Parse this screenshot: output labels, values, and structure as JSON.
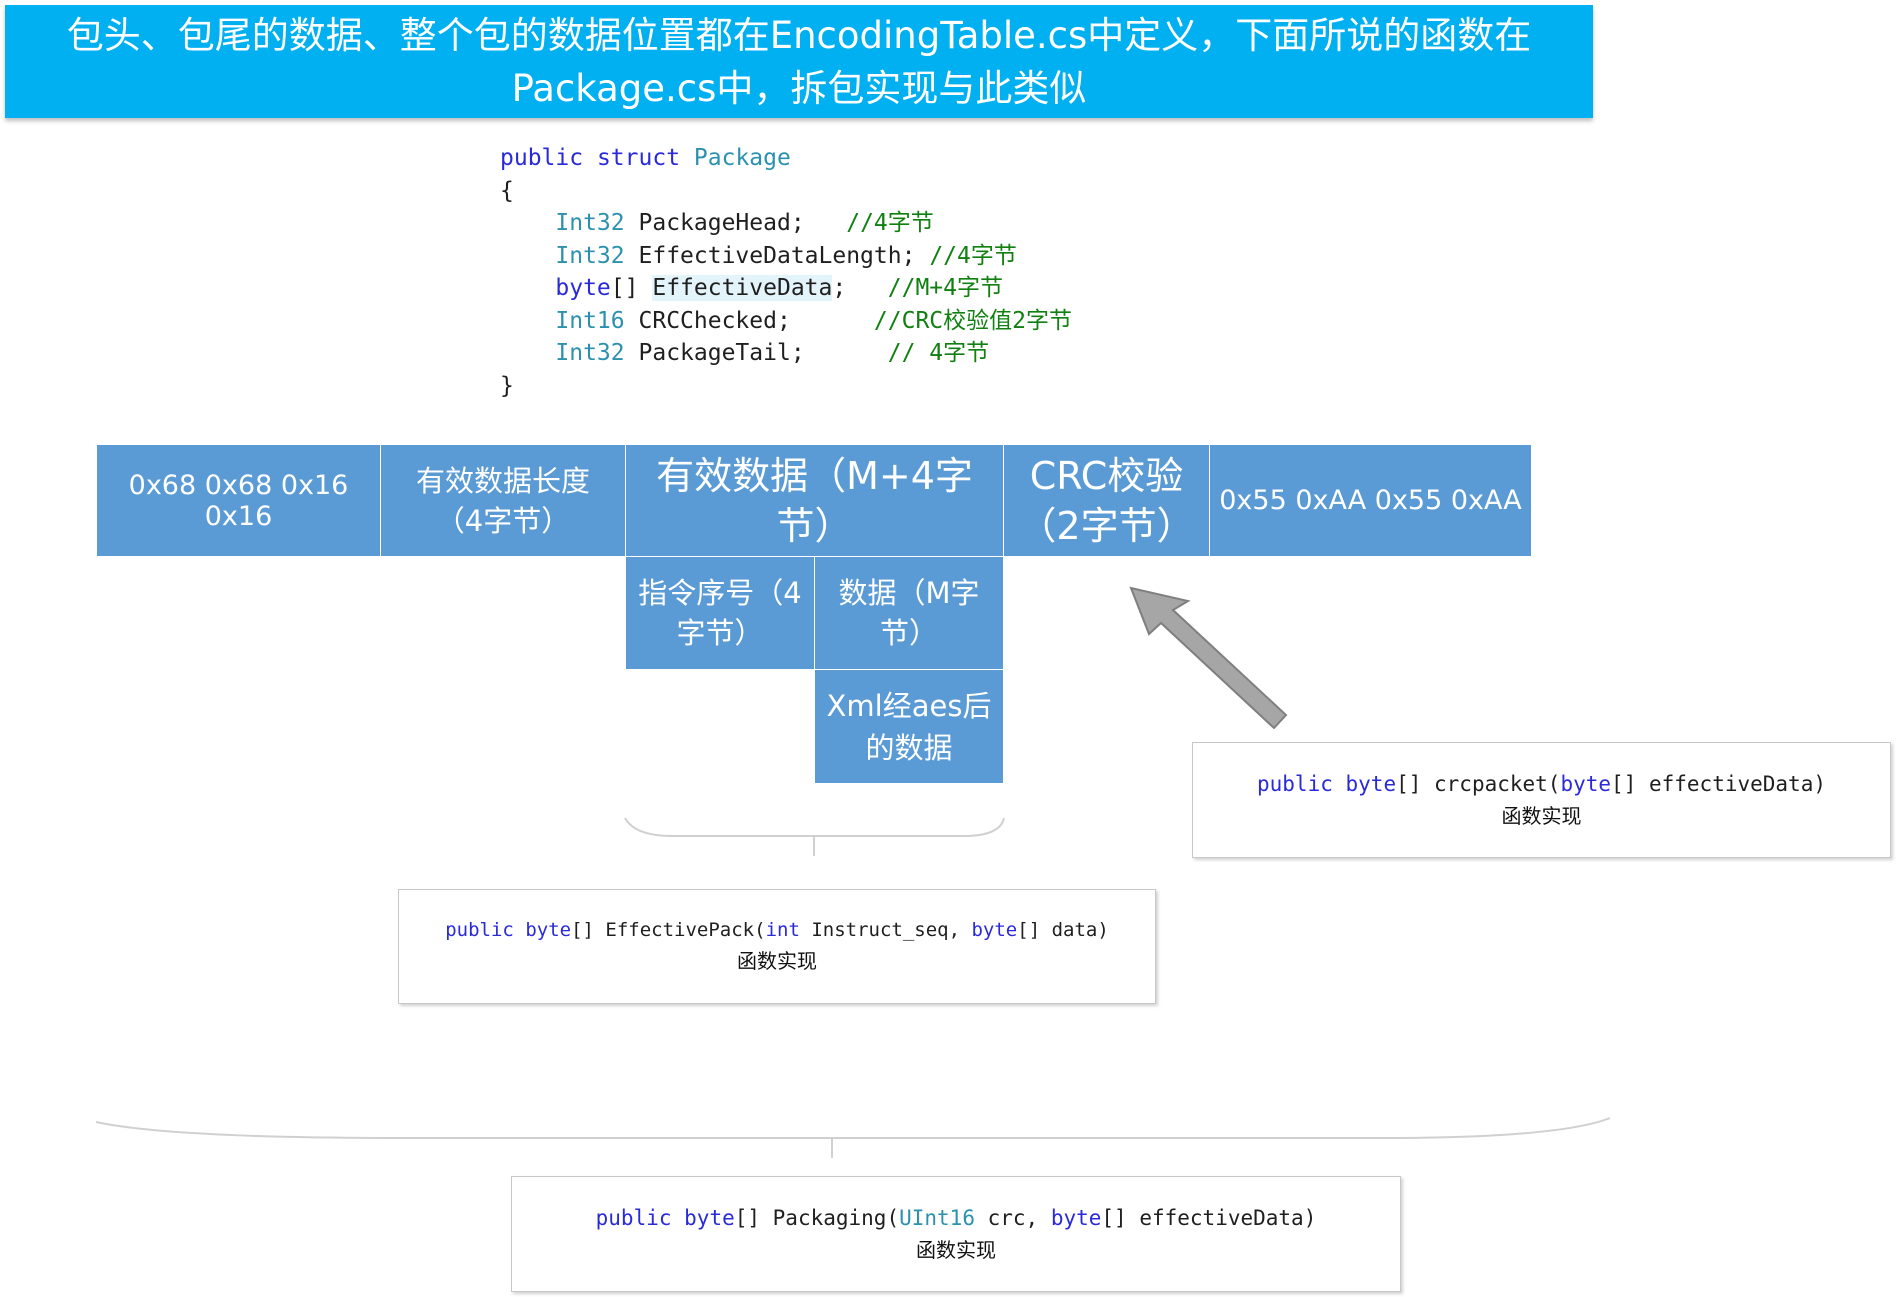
{
  "banner": {
    "line1": "包头、包尾的数据、整个包的数据位置都在EncodingTable.cs中定义，下面所说的函数在",
    "line2": "Package.cs中，拆包实现与此类似"
  },
  "code": {
    "decl_kw1": "public",
    "decl_kw2": "struct",
    "decl_name": "Package",
    "open_brace": "{",
    "close_brace": "}",
    "fields": [
      {
        "type": "Int32",
        "name": "PackageHead;",
        "comment": "//4字节"
      },
      {
        "type": "Int32",
        "name": "EffectiveDataLength;",
        "comment": "//4字节"
      },
      {
        "type": "byte",
        "name": "EffectiveData",
        "suffix": ";",
        "comment": "//M+4字节"
      },
      {
        "type": "Int16",
        "name": "CRCChecked;",
        "comment": "//CRC校验值2字节"
      },
      {
        "type": "Int32",
        "name": "PackageTail;",
        "comment": "// 4字节"
      }
    ],
    "brackets": "[]"
  },
  "packet": {
    "head": "0x68 0x68 0x16 0x16",
    "length_line1": "有效数据长度",
    "length_line2": "（4字节）",
    "data_line1": "有效数据（M+4字",
    "data_line2": "节）",
    "crc_line1": "CRC校验",
    "crc_line2": "（2字节）",
    "tail": "0x55 0xAA 0x55 0xAA",
    "seq_line1": "指令序号（4",
    "seq_line2": "字节）",
    "payload_line1": "数据（M字",
    "payload_line2": "节）",
    "xml_line1": "Xml经aes后",
    "xml_line2": "的数据"
  },
  "functions": {
    "crc": {
      "kw1": "public",
      "kw2": "byte",
      "rest1": "[] crcpacket(",
      "kw3": "byte",
      "rest2": "[] effectiveData)",
      "caption": "函数实现"
    },
    "effective": {
      "kw1": "public",
      "kw2": "byte",
      "rest1": "[] EffectivePack(",
      "kw3": "int",
      "rest2": " Instruct_seq, ",
      "kw4": "byte",
      "rest3": "[] data)",
      "caption": "函数实现"
    },
    "packaging": {
      "kw1": "public",
      "kw2": "byte",
      "rest1": "[] Packaging(",
      "type1": "UInt16",
      "rest2": " crc, ",
      "kw3": "byte",
      "rest3": "[] effectiveData)",
      "caption": "函数实现"
    }
  },
  "colors": {
    "banner": "#00b0f0",
    "cell": "#5b9bd5",
    "keyword": "#2a2adb",
    "type": "#2b91af",
    "comment": "#108010",
    "arrow": "#a6a6a6"
  }
}
